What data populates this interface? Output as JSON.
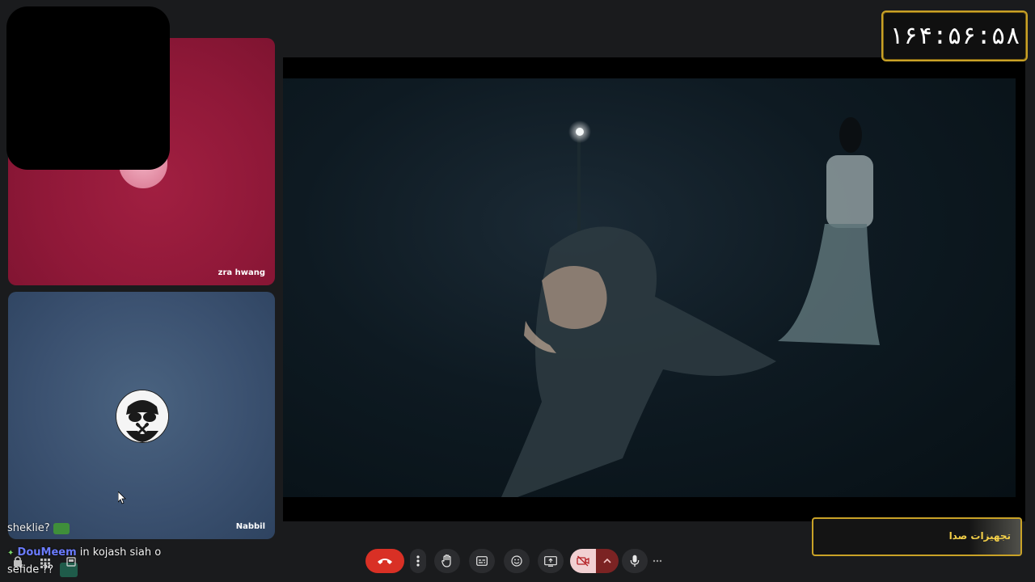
{
  "timer": {
    "display": "۱۶۴:۵۶:۵۸"
  },
  "participants": [
    {
      "name": "zra hwang",
      "tile_color": "#8f1838"
    },
    {
      "name": "Nabbil",
      "tile_color": "#3b5170"
    }
  ],
  "sound_settings": {
    "label": "تجهیزات صدا"
  },
  "chat": [
    {
      "user": "",
      "text": "sheklie?"
    },
    {
      "user": "DouMeem",
      "text": "in kojash siah o"
    },
    {
      "user": "",
      "text": "sefide ??"
    }
  ],
  "toolbar": {
    "end_call_icon": "phone-hangup-icon",
    "more_vertical_icon": "more-vertical-icon",
    "raise_hand_icon": "hand-icon",
    "captions_icon": "captions-icon",
    "emoji_icon": "emoji-icon",
    "present_icon": "present-screen-icon",
    "camera_icon": "camera-off-icon",
    "camera_menu_icon": "chevron-up-icon",
    "mic_icon": "microphone-icon",
    "more_horizontal_icon": "more-horizontal-icon"
  },
  "colors": {
    "accent_gold": "#c9a227",
    "end_call_red": "#d93025",
    "chat_username": "#6b7cff"
  }
}
